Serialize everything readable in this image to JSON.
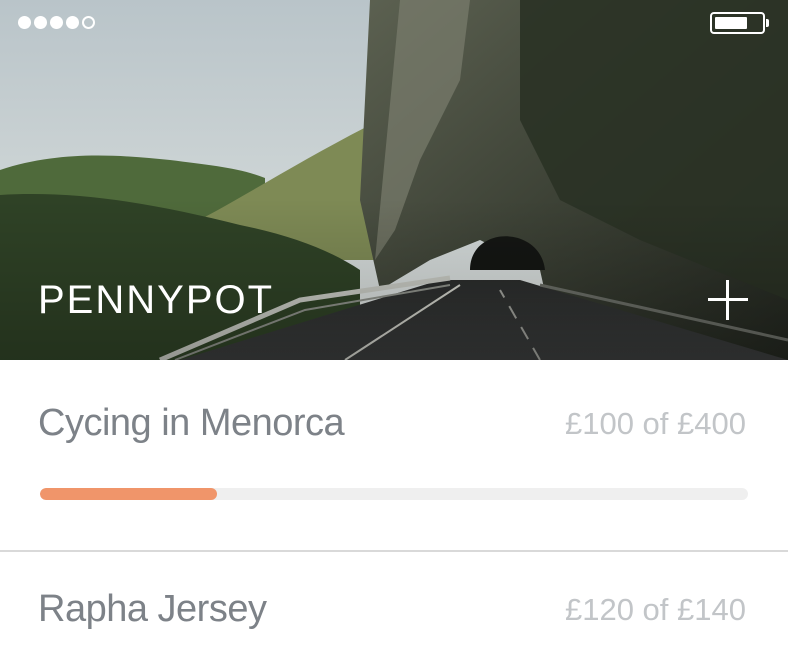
{
  "status_bar": {
    "signal_bars": 5,
    "signal_filled": 4,
    "battery_level": 0.72
  },
  "header": {
    "title": "PENNYPOT",
    "add_icon": "plus-icon"
  },
  "goals": [
    {
      "name": "Cycing in Menorca",
      "saved": "£100",
      "target": "£400",
      "progress_text": "£100 of £400",
      "progress": 0.25,
      "color": "#f0956a"
    },
    {
      "name": "Rapha Jersey",
      "saved": "£120",
      "target": "£140",
      "progress_text": "£120 of £140"
    }
  ],
  "colors": {
    "accent": "#f0956a",
    "track": "#efefef",
    "name_text": "#7d8288",
    "amount_text": "#c2c5c8"
  }
}
